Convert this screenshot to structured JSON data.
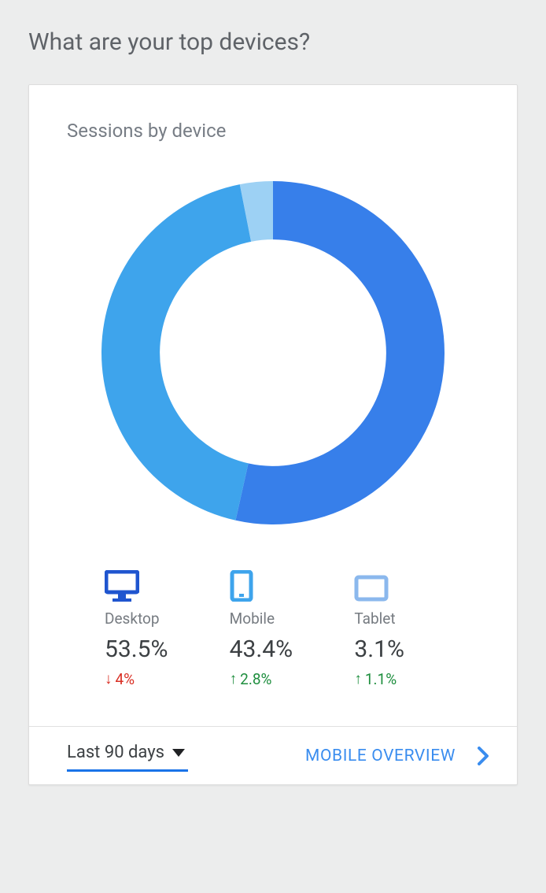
{
  "page_title": "What are your top devices?",
  "card_title": "Sessions by device",
  "chart_data": {
    "type": "pie",
    "title": "Sessions by device",
    "series": [
      {
        "name": "Desktop",
        "value": 53.5,
        "color": "#377fea"
      },
      {
        "name": "Mobile",
        "value": 43.4,
        "color": "#3ea4ec"
      },
      {
        "name": "Tablet",
        "value": 3.1,
        "color": "#9dd1f4"
      }
    ],
    "donut_inner_ratio": 0.66
  },
  "devices": [
    {
      "icon": "desktop-icon",
      "label": "Desktop",
      "value": "53.5%",
      "delta_dir": "down",
      "delta": "4%",
      "color": "#1f55cf"
    },
    {
      "icon": "mobile-icon",
      "label": "Mobile",
      "value": "43.4%",
      "delta_dir": "up",
      "delta": "2.8%",
      "color": "#3ea4ec"
    },
    {
      "icon": "tablet-icon",
      "label": "Tablet",
      "value": "3.1%",
      "delta_dir": "up",
      "delta": "1.1%",
      "color": "#8bb8ed"
    }
  ],
  "date_range_label": "Last 90 days",
  "overview_link_label": "MOBILE OVERVIEW"
}
